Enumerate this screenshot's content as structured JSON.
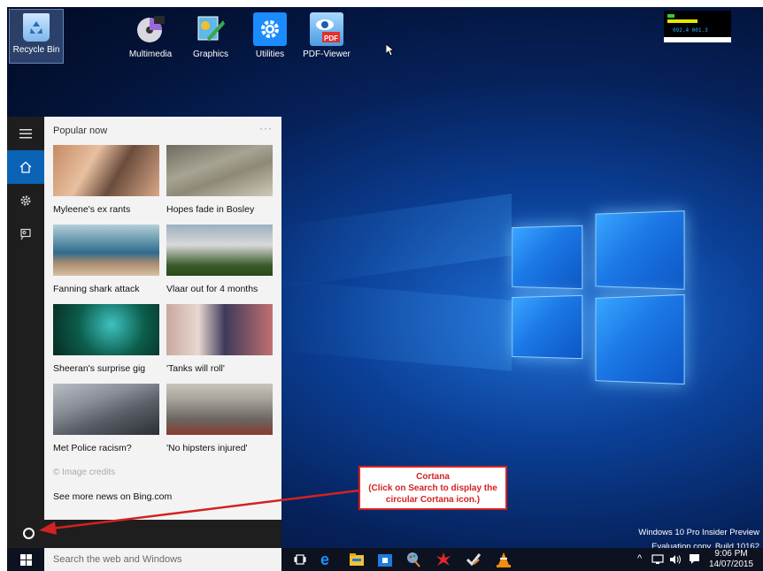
{
  "desktop": {
    "icons": [
      {
        "label": "Recycle Bin",
        "icon": "recycle-bin-icon"
      },
      {
        "label": "Multimedia",
        "icon": "multimedia-icon"
      },
      {
        "label": "Graphics",
        "icon": "graphics-icon"
      },
      {
        "label": "Utilities",
        "icon": "gear-icon"
      },
      {
        "label": "PDF-Viewer",
        "icon": "pdf-icon"
      }
    ]
  },
  "perfmon": {
    "text": "092.4   001.3"
  },
  "start_menu": {
    "rail": [
      "hamburger-icon",
      "home-icon",
      "settings-icon",
      "feedback-icon"
    ],
    "header": "Popular now",
    "more": "···",
    "news": [
      {
        "caption": "Myleene's ex rants",
        "colors": [
          "#c48a63",
          "#6b4c3c"
        ]
      },
      {
        "caption": "Hopes fade in Bosley",
        "colors": [
          "#8d8878",
          "#5d5a50"
        ]
      },
      {
        "caption": "Fanning shark attack",
        "colors": [
          "#2e6c8e",
          "#b4d0d8"
        ]
      },
      {
        "caption": "Vlaar out for 4 months",
        "colors": [
          "#3a5a2a",
          "#d8d8d8"
        ]
      },
      {
        "caption": "Sheeran's surprise gig",
        "colors": [
          "#0c5e4c",
          "#3fc2c0"
        ]
      },
      {
        "caption": "'Tanks will roll'",
        "colors": [
          "#3f3a5a",
          "#c8a8a0"
        ]
      },
      {
        "caption": "Met Police racism?",
        "colors": [
          "#5a5f68",
          "#b8bcc4"
        ]
      },
      {
        "caption": "'No hipsters injured'",
        "colors": [
          "#6a6660",
          "#a8a49c"
        ]
      }
    ],
    "credits": "© Image credits",
    "see_more": "See more news on Bing.com"
  },
  "taskbar": {
    "search_placeholder": "Search the web and Windows",
    "apps": [
      "task-view-icon",
      "edge-icon",
      "file-explorer-icon",
      "store-icon",
      "paint-icon",
      "bug-icon",
      "check-icon",
      "vlc-icon"
    ],
    "tray": {
      "time": "9:06 PM",
      "date": "14/07/2015"
    }
  },
  "watermark": {
    "line1": "Windows 10 Pro Insider Preview",
    "line2": "Evaluation copy. Build 10162"
  },
  "callout": {
    "title": "Cortana",
    "line1": "(Click on Search to display the",
    "line2": "circular Cortana icon.)"
  },
  "colors": {
    "accent": "#0a63b5",
    "callout": "#d32222"
  }
}
